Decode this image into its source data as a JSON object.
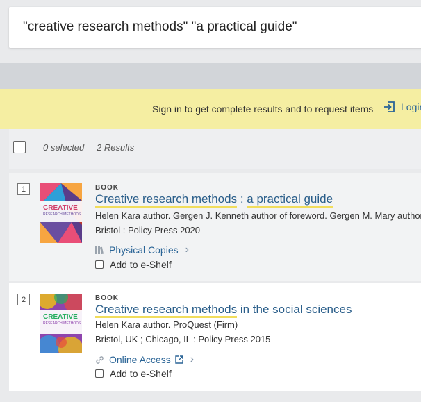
{
  "search": {
    "query": "\"creative research methods\" \"a practical guide\""
  },
  "signin": {
    "message": "Sign in to get complete results and to request items",
    "login_label": "Login"
  },
  "toolbar": {
    "selected": "0 selected",
    "results": "2 Results"
  },
  "results": [
    {
      "number": "1",
      "type": "BOOK",
      "title_parts": [
        "Creative research methods",
        " : ",
        "a practical guide"
      ],
      "authors": "Helen Kara author. Gergen J. Kenneth author of foreword. Gergen M. Mary author",
      "publisher": "Bristol : Policy Press 2020",
      "access_label": "Physical Copies",
      "access_icon": "book-stack-icon",
      "eshelf_label": "Add to e-Shelf",
      "cover_title": "CREATIVE",
      "cover_sub": "RESEARCH METHODS",
      "cover_colors": [
        "#e94e77",
        "#f7a541",
        "#6a4ea0",
        "#2e9fd8",
        "#c0392b"
      ]
    },
    {
      "number": "2",
      "type": "BOOK",
      "title_parts": [
        "Creative research methods",
        " in the social sciences"
      ],
      "authors": "Helen Kara author. ProQuest (Firm)",
      "publisher": "Bristol, UK ; Chicago, IL : Policy Press 2015",
      "access_label": "Online Access",
      "access_icon": "link-icon",
      "eshelf_label": "Add to e-Shelf",
      "cover_title": "CREATIVE",
      "cover_sub": "RESEARCH METHODS",
      "cover_colors": [
        "#8e44ad",
        "#27ae60",
        "#f1c40f",
        "#e74c3c",
        "#3498db"
      ]
    }
  ],
  "colors": {
    "accent": "#2a5e8a",
    "highlight": "#f1dd5c",
    "signin_bg": "#f5eea2"
  }
}
